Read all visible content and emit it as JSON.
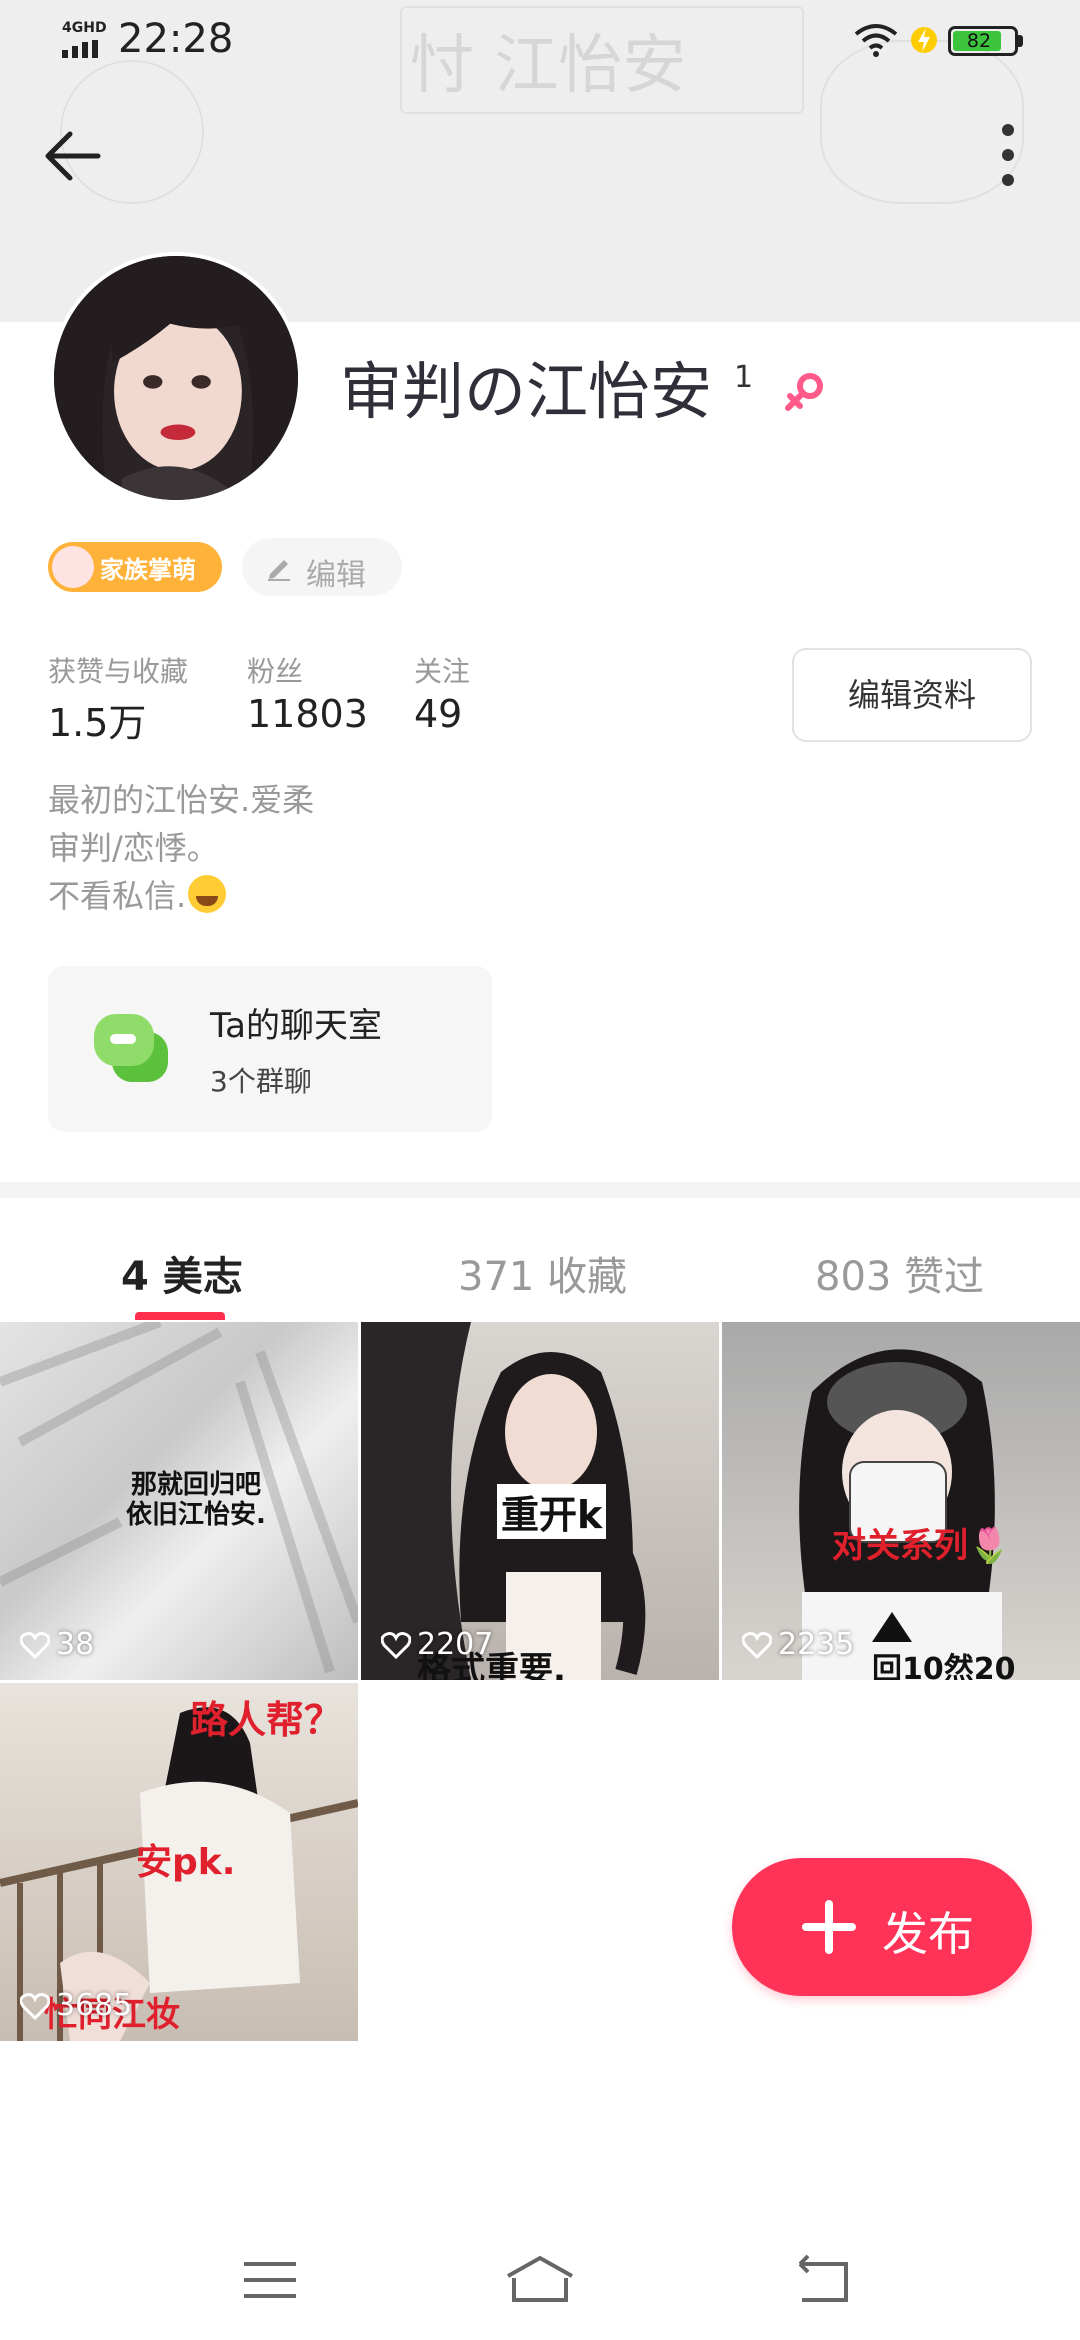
{
  "status_bar": {
    "network": "4GHD",
    "time": "22:28",
    "battery": "82"
  },
  "header": {
    "background_text": "忖 江怡安"
  },
  "profile": {
    "username": "审判の江怡安",
    "username_sup": "1",
    "family_badge": "家族掌萌",
    "edit_tag": "编辑",
    "edit_profile_button": "编辑资料",
    "stats": [
      {
        "label": "获赞与收藏",
        "value": "1.5万"
      },
      {
        "label": "粉丝",
        "value": "11803"
      },
      {
        "label": "关注",
        "value": "49"
      }
    ],
    "bio": [
      "最初的江怡安.爱柔",
      "审判/恋悸。",
      "不看私信."
    ]
  },
  "chat_room": {
    "title": "Ta的聊天室",
    "subtitle": "3个群聊"
  },
  "tabs": [
    {
      "label": "4 美志",
      "active": true
    },
    {
      "label": "371 收藏",
      "active": false
    },
    {
      "label": "803 赞过",
      "active": false
    }
  ],
  "notes": [
    {
      "likes": "38",
      "caption": "那就回归吧\n依旧江怡安."
    },
    {
      "likes": "2207",
      "caption": "重开k",
      "caption2": "格式重要."
    },
    {
      "likes": "2235",
      "caption": "对关系列🌷",
      "caption2": "回10然20"
    },
    {
      "likes": "3685",
      "caption": "路人帮？",
      "caption2": "安pk.",
      "caption3": "忙同江妆"
    }
  ],
  "publish_button": "发布",
  "colors": {
    "accent": "#ff3358",
    "badge": "#ffb23a",
    "gender": "#ff5a8a",
    "chat_icon": "#7cd25a"
  }
}
